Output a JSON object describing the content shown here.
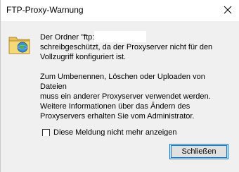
{
  "window": {
    "title": "FTP-Proxy-Warnung",
    "close_glyph": "✕"
  },
  "dialog": {
    "icon": "ftp-folder-globe-icon",
    "paragraph1": "Der Ordner \"ftp:                    26:2121/\" ist\nschreibgeschützt, da der Proxyserver nicht für den\nVollzugriff konfiguriert ist.",
    "paragraph2": "Zum Umbenennen, Löschen oder Uploaden von Dateien\nmuss ein anderer Proxyserver verwendet werden.\nWeitere Informationen über das Ändern des\nProxyservers erhalten Sie vom Administrator.",
    "checkbox_label": "Diese Meldung nicht mehr anzeigen",
    "checkbox_checked": false,
    "close_button_label": "Schließen"
  },
  "colors": {
    "accent": "#0078d7",
    "content_bg": "#f0f0f0",
    "title_bg": "#ffffff"
  }
}
